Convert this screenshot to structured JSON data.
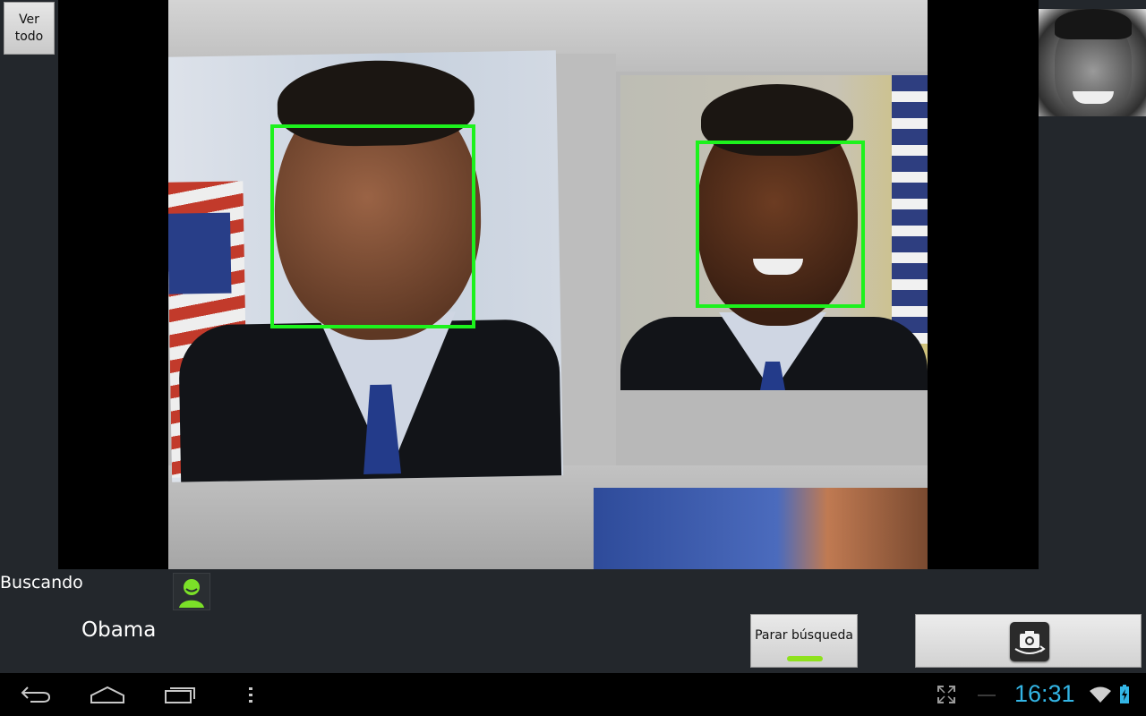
{
  "top_left": {
    "view_all_label": "Ver\ntodo"
  },
  "camera": {
    "faces_detected": 2
  },
  "status": {
    "text": "Buscando",
    "name": "Obama"
  },
  "buttons": {
    "stop_search_label": "Parar búsqueda",
    "switch_camera_icon": "switch-camera-icon"
  },
  "system_bar": {
    "time": "16:31",
    "icons": [
      "back-icon",
      "home-icon",
      "recent-apps-icon",
      "menu-icon",
      "fullscreen-icon",
      "wifi-icon",
      "battery-icon"
    ]
  },
  "colors": {
    "face_box": "#1df21d",
    "clock": "#33b5e5",
    "indicator": "#8ee11d",
    "background": "#23272c"
  }
}
